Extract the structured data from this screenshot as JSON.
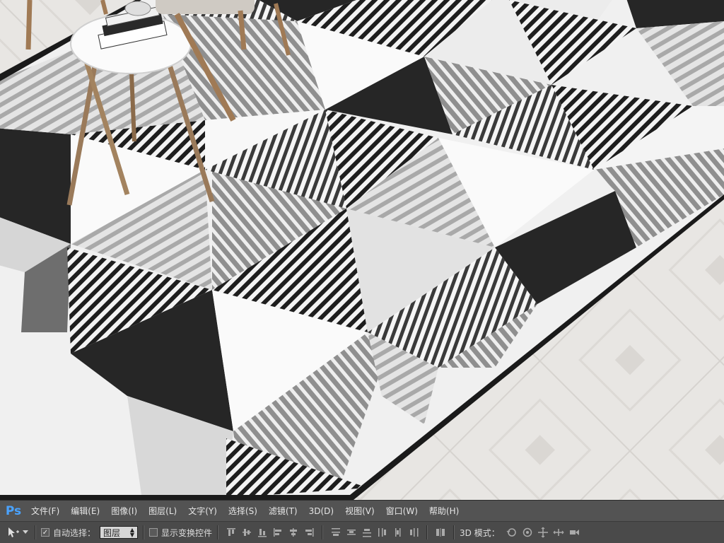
{
  "app": {
    "logo": "Ps"
  },
  "menu": [
    {
      "label": "文件(F)"
    },
    {
      "label": "编辑(E)"
    },
    {
      "label": "图像(I)"
    },
    {
      "label": "图层(L)"
    },
    {
      "label": "文字(Y)"
    },
    {
      "label": "选择(S)"
    },
    {
      "label": "滤镜(T)"
    },
    {
      "label": "3D(D)"
    },
    {
      "label": "视图(V)"
    },
    {
      "label": "窗口(W)"
    },
    {
      "label": "帮助(H)"
    }
  ],
  "options": {
    "move_tool_icon": "move-tool-icon",
    "auto_select": {
      "label": "自动选择：",
      "checked": true
    },
    "layer_select": {
      "value": "图层"
    },
    "show_transform": {
      "label": "显示变换控件",
      "checked": false
    },
    "mode_3d_label": "3D 模式："
  },
  "colors": {
    "accent": "#4aa3ff",
    "menubar": "#535353",
    "optionsbar": "#4a4a4a",
    "rug_dark": "#262626",
    "rug_white": "#fafafa",
    "rug_light": "#d8d8d8",
    "rug_stripe": "#8f8f8f"
  }
}
